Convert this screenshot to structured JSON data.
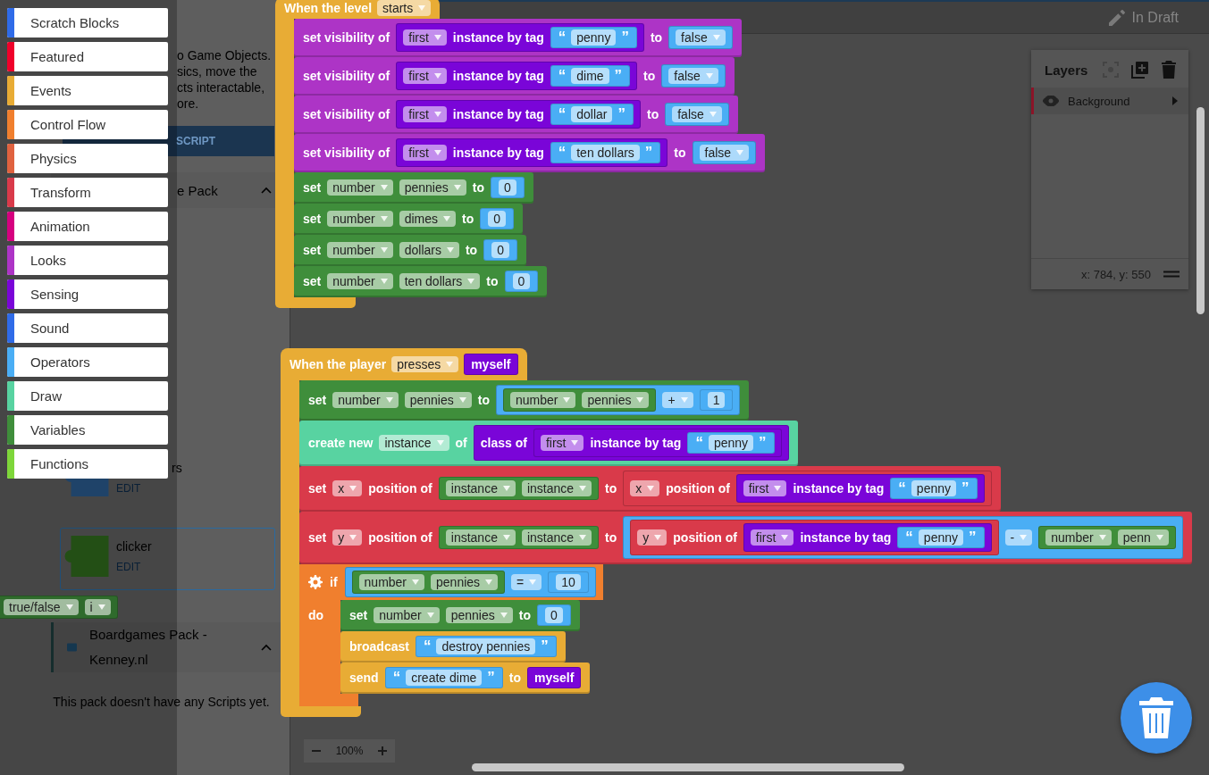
{
  "top_bar": {
    "status": "In Draft"
  },
  "left_panel": {
    "description": [
      "o Game Objects.",
      "sics, move the",
      "cts interactable,",
      "ore."
    ],
    "add_button": "SCRIPT",
    "packs": [
      {
        "title": "e Pack",
        "expanded": true,
        "scripts": [
          {
            "name": "rs",
            "action": "EDIT",
            "selected": false
          },
          {
            "name": "clicker",
            "action": "EDIT",
            "selected": true
          }
        ]
      },
      {
        "title": "Boardgames Pack - Kenney.nl",
        "expanded": true,
        "empty_message": "This pack doesn't have any Scripts yet."
      }
    ]
  },
  "categories": [
    {
      "label": "Scratch Blocks",
      "color": "#2f6be8",
      "selected": false
    },
    {
      "label": "Featured",
      "color": "#f0002a",
      "selected": false
    },
    {
      "label": "Events",
      "color": "#e8ac35",
      "selected": false
    },
    {
      "label": "Control Flow",
      "color": "#f07f2e",
      "selected": false
    },
    {
      "label": "Physics",
      "color": "#e0623f",
      "selected": false
    },
    {
      "label": "Transform",
      "color": "#d93a4a",
      "selected": false
    },
    {
      "label": "Animation",
      "color": "#d6007f",
      "selected": false
    },
    {
      "label": "Looks",
      "color": "#ad34c6",
      "selected": false
    },
    {
      "label": "Sensing",
      "color": "#7a05d8",
      "selected": false
    },
    {
      "label": "Sound",
      "color": "#2f6be8",
      "selected": false
    },
    {
      "label": "Operators",
      "color": "#4aaef5",
      "selected": false
    },
    {
      "label": "Draw",
      "color": "#58d3a1",
      "selected": false
    },
    {
      "label": "Variables",
      "color": "#3f8e3b",
      "selected": false
    },
    {
      "label": "Functions",
      "color": "#7ed63a",
      "selected": false
    }
  ],
  "floating_block": {
    "kind": "reporter",
    "color": "#2f6b2c",
    "parts": [
      {
        "kind": "dropdown",
        "text": "true/false"
      },
      {
        "kind": "dropdown",
        "text": "i"
      }
    ]
  },
  "canvas": {
    "zoom": "100%",
    "scripts": [
      {
        "color": "#e8ac35",
        "parts": [
          {
            "kind": "label",
            "text": "When the level"
          },
          {
            "kind": "dropdown",
            "text": "starts"
          }
        ],
        "body": [
          {
            "kind": "statement",
            "color": "#ad34c6",
            "parts": [
              {
                "kind": "label",
                "text": "set visibility of"
              },
              {
                "kind": "reporter",
                "color": "#7a05d8",
                "parts": [
                  {
                    "kind": "dropdown",
                    "text": "first"
                  },
                  {
                    "kind": "label",
                    "text": "instance by tag"
                  },
                  {
                    "kind": "string",
                    "open": "“",
                    "text": "penny",
                    "close": "”"
                  }
                ]
              },
              {
                "kind": "label",
                "text": "to"
              },
              {
                "kind": "reporter",
                "color": "#4aaef5",
                "parts": [
                  {
                    "kind": "dropdown",
                    "text": "false"
                  }
                ]
              }
            ]
          },
          {
            "kind": "statement",
            "color": "#ad34c6",
            "parts": [
              {
                "kind": "label",
                "text": "set visibility of"
              },
              {
                "kind": "reporter",
                "color": "#7a05d8",
                "parts": [
                  {
                    "kind": "dropdown",
                    "text": "first"
                  },
                  {
                    "kind": "label",
                    "text": "instance by tag"
                  },
                  {
                    "kind": "string",
                    "open": "“",
                    "text": "dime",
                    "close": "”"
                  }
                ]
              },
              {
                "kind": "label",
                "text": "to"
              },
              {
                "kind": "reporter",
                "color": "#4aaef5",
                "parts": [
                  {
                    "kind": "dropdown",
                    "text": "false"
                  }
                ]
              }
            ]
          },
          {
            "kind": "statement",
            "color": "#ad34c6",
            "parts": [
              {
                "kind": "label",
                "text": "set visibility of"
              },
              {
                "kind": "reporter",
                "color": "#7a05d8",
                "parts": [
                  {
                    "kind": "dropdown",
                    "text": "first"
                  },
                  {
                    "kind": "label",
                    "text": "instance by tag"
                  },
                  {
                    "kind": "string",
                    "open": "“",
                    "text": "dollar",
                    "close": "”"
                  }
                ]
              },
              {
                "kind": "label",
                "text": "to"
              },
              {
                "kind": "reporter",
                "color": "#4aaef5",
                "parts": [
                  {
                    "kind": "dropdown",
                    "text": "false"
                  }
                ]
              }
            ]
          },
          {
            "kind": "statement",
            "color": "#ad34c6",
            "parts": [
              {
                "kind": "label",
                "text": "set visibility of"
              },
              {
                "kind": "reporter",
                "color": "#7a05d8",
                "parts": [
                  {
                    "kind": "dropdown",
                    "text": "first"
                  },
                  {
                    "kind": "label",
                    "text": "instance by tag"
                  },
                  {
                    "kind": "string",
                    "open": "“",
                    "text": "ten dollars",
                    "close": "”"
                  }
                ]
              },
              {
                "kind": "label",
                "text": "to"
              },
              {
                "kind": "reporter",
                "color": "#4aaef5",
                "parts": [
                  {
                    "kind": "dropdown",
                    "text": "false"
                  }
                ]
              }
            ]
          },
          {
            "kind": "statement",
            "color": "#3f8e3b",
            "parts": [
              {
                "kind": "label",
                "text": "set"
              },
              {
                "kind": "dropdown",
                "text": "number"
              },
              {
                "kind": "dropdown",
                "text": "pennies"
              },
              {
                "kind": "label",
                "text": "to"
              },
              {
                "kind": "number",
                "text": "0"
              }
            ]
          },
          {
            "kind": "statement",
            "color": "#3f8e3b",
            "parts": [
              {
                "kind": "label",
                "text": "set"
              },
              {
                "kind": "dropdown",
                "text": "number"
              },
              {
                "kind": "dropdown",
                "text": "dimes"
              },
              {
                "kind": "label",
                "text": "to"
              },
              {
                "kind": "number",
                "text": "0"
              }
            ]
          },
          {
            "kind": "statement",
            "color": "#3f8e3b",
            "parts": [
              {
                "kind": "label",
                "text": "set"
              },
              {
                "kind": "dropdown",
                "text": "number"
              },
              {
                "kind": "dropdown",
                "text": "dollars"
              },
              {
                "kind": "label",
                "text": "to"
              },
              {
                "kind": "number",
                "text": "0"
              }
            ]
          },
          {
            "kind": "statement",
            "color": "#3f8e3b",
            "parts": [
              {
                "kind": "label",
                "text": "set"
              },
              {
                "kind": "dropdown",
                "text": "number"
              },
              {
                "kind": "dropdown",
                "text": "ten dollars"
              },
              {
                "kind": "label",
                "text": "to"
              },
              {
                "kind": "number",
                "text": "0"
              }
            ]
          }
        ]
      },
      {
        "color": "#e8ac35",
        "parts": [
          {
            "kind": "label",
            "text": "When the player"
          },
          {
            "kind": "dropdown",
            "text": "presses"
          },
          {
            "kind": "reporter",
            "color": "#7a05d8",
            "parts": [
              {
                "kind": "label",
                "text": "myself"
              }
            ]
          }
        ],
        "body": [
          {
            "kind": "statement",
            "color": "#3f8e3b",
            "parts": [
              {
                "kind": "label",
                "text": "set"
              },
              {
                "kind": "dropdown",
                "text": "number"
              },
              {
                "kind": "dropdown",
                "text": "pennies"
              },
              {
                "kind": "label",
                "text": "to"
              },
              {
                "kind": "reporter",
                "color": "#4aaef5",
                "parts": [
                  {
                    "kind": "reporter",
                    "color": "#3f8e3b",
                    "parts": [
                      {
                        "kind": "dropdown",
                        "text": "number"
                      },
                      {
                        "kind": "dropdown",
                        "text": "pennies"
                      }
                    ]
                  },
                  {
                    "kind": "dropdown",
                    "text": "+"
                  },
                  {
                    "kind": "number",
                    "text": "1"
                  }
                ]
              }
            ]
          },
          {
            "kind": "statement",
            "color": "#58d3a1",
            "parts": [
              {
                "kind": "label",
                "text": "create new"
              },
              {
                "kind": "dropdown",
                "text": "instance"
              },
              {
                "kind": "label",
                "text": "of"
              },
              {
                "kind": "reporter",
                "color": "#7a05d8",
                "parts": [
                  {
                    "kind": "label",
                    "text": "class of"
                  },
                  {
                    "kind": "reporter",
                    "color": "#7a05d8",
                    "parts": [
                      {
                        "kind": "dropdown",
                        "text": "first"
                      },
                      {
                        "kind": "label",
                        "text": "instance by tag"
                      },
                      {
                        "kind": "string",
                        "open": "“",
                        "text": "penny",
                        "close": "”"
                      }
                    ]
                  }
                ]
              }
            ]
          },
          {
            "kind": "statement",
            "color": "#d93a4a",
            "parts": [
              {
                "kind": "label",
                "text": "set"
              },
              {
                "kind": "dropdown",
                "text": "x"
              },
              {
                "kind": "label",
                "text": "position of"
              },
              {
                "kind": "reporter",
                "color": "#3f8e3b",
                "parts": [
                  {
                    "kind": "dropdown",
                    "text": "instance"
                  },
                  {
                    "kind": "dropdown",
                    "text": "instance"
                  }
                ]
              },
              {
                "kind": "label",
                "text": "to"
              },
              {
                "kind": "reporter",
                "color": "#d93a4a",
                "parts": [
                  {
                    "kind": "dropdown",
                    "text": "x"
                  },
                  {
                    "kind": "label",
                    "text": "position of"
                  },
                  {
                    "kind": "reporter",
                    "color": "#7a05d8",
                    "parts": [
                      {
                        "kind": "dropdown",
                        "text": "first"
                      },
                      {
                        "kind": "label",
                        "text": "instance by tag"
                      },
                      {
                        "kind": "string",
                        "open": "“",
                        "text": "penny",
                        "close": "”"
                      }
                    ]
                  }
                ]
              }
            ]
          },
          {
            "kind": "statement",
            "color": "#d93a4a",
            "parts": [
              {
                "kind": "label",
                "text": "set"
              },
              {
                "kind": "dropdown",
                "text": "y"
              },
              {
                "kind": "label",
                "text": "position of"
              },
              {
                "kind": "reporter",
                "color": "#3f8e3b",
                "parts": [
                  {
                    "kind": "dropdown",
                    "text": "instance"
                  },
                  {
                    "kind": "dropdown",
                    "text": "instance"
                  }
                ]
              },
              {
                "kind": "label",
                "text": "to"
              },
              {
                "kind": "reporter",
                "color": "#4aaef5",
                "parts": [
                  {
                    "kind": "reporter",
                    "color": "#d93a4a",
                    "parts": [
                      {
                        "kind": "dropdown",
                        "text": "y"
                      },
                      {
                        "kind": "label",
                        "text": "position of"
                      },
                      {
                        "kind": "reporter",
                        "color": "#7a05d8",
                        "parts": [
                          {
                            "kind": "dropdown",
                            "text": "first"
                          },
                          {
                            "kind": "label",
                            "text": "instance by tag"
                          },
                          {
                            "kind": "string",
                            "open": "“",
                            "text": "penny",
                            "close": "”"
                          }
                        ]
                      }
                    ]
                  },
                  {
                    "kind": "dropdown",
                    "text": "-"
                  },
                  {
                    "kind": "reporter",
                    "color": "#3f8e3b",
                    "parts": [
                      {
                        "kind": "dropdown",
                        "text": "number"
                      },
                      {
                        "kind": "dropdown",
                        "text": "penn"
                      }
                    ]
                  }
                ]
              }
            ]
          },
          {
            "kind": "if",
            "color": "#f07f2e",
            "parts": [
              {
                "kind": "label",
                "text": "if"
              },
              {
                "kind": "reporter",
                "color": "#4aaef5",
                "parts": [
                  {
                    "kind": "reporter",
                    "color": "#3f8e3b",
                    "parts": [
                      {
                        "kind": "dropdown",
                        "text": "number"
                      },
                      {
                        "kind": "dropdown",
                        "text": "pennies"
                      }
                    ]
                  },
                  {
                    "kind": "dropdown",
                    "text": "="
                  },
                  {
                    "kind": "number",
                    "text": "10"
                  }
                ]
              }
            ],
            "do_label": "do",
            "children": [
              {
                "kind": "statement",
                "color": "#3f8e3b",
                "parts": [
                  {
                    "kind": "label",
                    "text": "set"
                  },
                  {
                    "kind": "dropdown",
                    "text": "number"
                  },
                  {
                    "kind": "dropdown",
                    "text": "pennies"
                  },
                  {
                    "kind": "label",
                    "text": "to"
                  },
                  {
                    "kind": "number",
                    "text": "0"
                  }
                ]
              },
              {
                "kind": "statement",
                "color": "#e8ac35",
                "parts": [
                  {
                    "kind": "label",
                    "text": "broadcast"
                  },
                  {
                    "kind": "string",
                    "open": "“",
                    "text": "destroy pennies",
                    "close": "”"
                  }
                ]
              },
              {
                "kind": "statement",
                "color": "#e8ac35",
                "parts": [
                  {
                    "kind": "label",
                    "text": "send"
                  },
                  {
                    "kind": "string",
                    "open": "“",
                    "text": "create dime",
                    "close": "”"
                  },
                  {
                    "kind": "label",
                    "text": "to"
                  },
                  {
                    "kind": "reporter",
                    "color": "#7a05d8",
                    "parts": [
                      {
                        "kind": "label",
                        "text": "myself"
                      }
                    ]
                  }
                ]
              }
            ]
          }
        ]
      }
    ]
  },
  "layers": {
    "title": "Layers",
    "items": [
      {
        "name": "Background",
        "visible": true,
        "selected": true
      }
    ],
    "coordinates": "x: 784, y: 550"
  }
}
